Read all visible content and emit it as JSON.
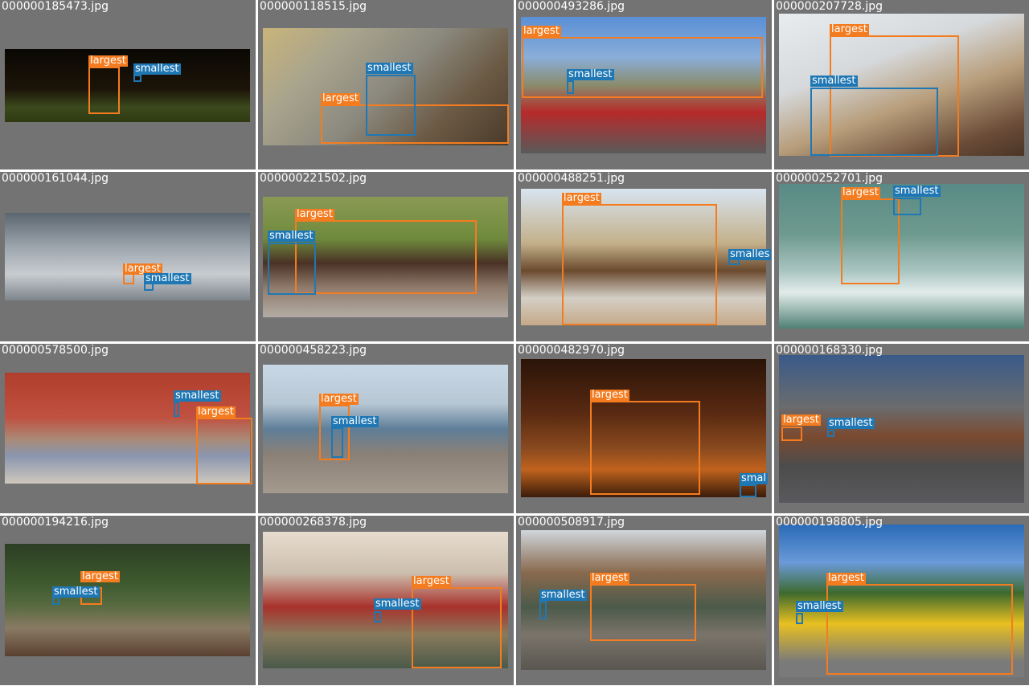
{
  "colors": {
    "background": "#737373",
    "largest_box": "#f47c20",
    "smallest_box": "#1f77b4",
    "filename_text": "#ffffff"
  },
  "cells": [
    {
      "filename": "000000185473.jpg",
      "scene": "horses running at dusk",
      "largest_label": "largest",
      "smallest_label": "smallest"
    },
    {
      "filename": "000000118515.jpg",
      "scene": "kitten on wooden bench",
      "largest_label": "largest",
      "smallest_label": "smallest"
    },
    {
      "filename": "000000493286.jpg",
      "scene": "bomber plane and red vintage car",
      "largest_label": "largest",
      "smallest_label": "smallest"
    },
    {
      "filename": "000000207728.jpg",
      "scene": "bighorn sheep in snow",
      "largest_label": "largest",
      "smallest_label": "smallest"
    },
    {
      "filename": "000000161044.jpg",
      "scene": "birds against cloudy sky",
      "largest_label": "largest",
      "smallest_label": "smallest"
    },
    {
      "filename": "000000221502.jpg",
      "scene": "park bench with flowers",
      "largest_label": "largest",
      "smallest_label": "smallest"
    },
    {
      "filename": "000000488251.jpg",
      "scene": "cowboy with horse",
      "largest_label": "largest",
      "smallest_label": "smalles"
    },
    {
      "filename": "000000252701.jpg",
      "scene": "surfer riding wave",
      "largest_label": "largest",
      "smallest_label": "smallest"
    },
    {
      "filename": "000000578500.jpg",
      "scene": "living room interior",
      "largest_label": "largest",
      "smallest_label": "smallest"
    },
    {
      "filename": "000000458223.jpg",
      "scene": "lighthouse and rocky jetty",
      "largest_label": "largest",
      "smallest_label": "smallest"
    },
    {
      "filename": "000000482970.jpg",
      "scene": "laptop on desk",
      "largest_label": "largest",
      "smallest_label": "smal"
    },
    {
      "filename": "000000168330.jpg",
      "scene": "street clock at night",
      "largest_label": "largest",
      "smallest_label": "smallest"
    },
    {
      "filename": "000000194216.jpg",
      "scene": "forest with fallen logs",
      "largest_label": "largest",
      "smallest_label": "smallest"
    },
    {
      "filename": "000000268378.jpg",
      "scene": "group dinner",
      "largest_label": "largest",
      "smallest_label": "smallest"
    },
    {
      "filename": "000000508917.jpg",
      "scene": "train at station",
      "largest_label": "largest",
      "smallest_label": "smallest"
    },
    {
      "filename": "000000198805.jpg",
      "scene": "yellow pickup truck",
      "largest_label": "largest",
      "smallest_label": "smallest"
    }
  ]
}
